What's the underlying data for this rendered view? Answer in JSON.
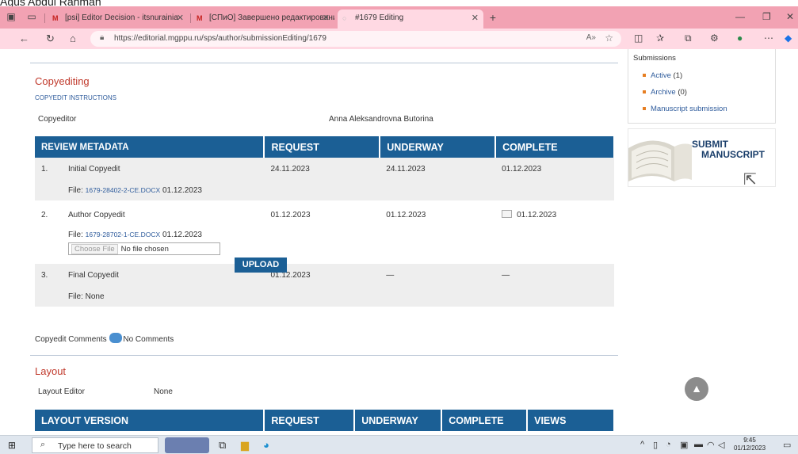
{
  "caption": "Agus Abdul Rahman",
  "browser": {
    "tabs": [
      {
        "label": "[psi] Editor Decision - itsnurainia",
        "favicon": "M"
      },
      {
        "label": "[СПиО] Завершено редактирование",
        "favicon": "M"
      },
      {
        "label": "#1679 Editing",
        "favicon": "loading"
      }
    ],
    "new_tab": "+",
    "url": "https://editorial.mgppu.ru/sps/author/submissionEditing/1679"
  },
  "copyediting": {
    "title": "Copyediting",
    "instructions_link": "COPYEDIT INSTRUCTIONS",
    "copyeditor_label": "Copyeditor",
    "copyeditor_name": "Anna Aleksandrovna Butorina",
    "headers": [
      "REVIEW METADATA",
      "REQUEST",
      "UNDERWAY",
      "COMPLETE"
    ],
    "rows": [
      {
        "num": "1.",
        "name": "Initial Copyedit",
        "request": "24.11.2023",
        "underway": "24.11.2023",
        "complete": "01.12.2023",
        "file_label": "File:",
        "file": "1679-28402-2-CE.DOCX",
        "file_date": "01.12.2023"
      },
      {
        "num": "2.",
        "name": "Author Copyedit",
        "request": "01.12.2023",
        "underway": "01.12.2023",
        "complete": "01.12.2023",
        "file_label": "File:",
        "file": "1679-28702-1-CE.DOCX",
        "file_date": "01.12.2023"
      },
      {
        "num": "3.",
        "name": "Final Copyedit",
        "request": "01.12.2023",
        "underway": "—",
        "complete": "—",
        "file_label": "File: None"
      }
    ],
    "choose_file_button": "Choose File",
    "no_file": "No file chosen",
    "upload_button": "UPLOAD",
    "comments_label": "Copyedit Comments",
    "comments_value": "No Comments"
  },
  "layout": {
    "title": "Layout",
    "editor_label": "Layout Editor",
    "editor_value": "None",
    "headers": [
      "LAYOUT VERSION",
      "REQUEST",
      "UNDERWAY",
      "COMPLETE",
      "VIEWS"
    ]
  },
  "sidebar": {
    "heading": "Submissions",
    "active_label": "Active",
    "active_count": "(1)",
    "archive_label": "Archive",
    "archive_count": "(0)",
    "manuscript_link": "Manuscript submission",
    "submit_line1": "SUBMIT",
    "submit_line2": "MANUSCRIPT"
  },
  "taskbar": {
    "search_placeholder": "Type here to search",
    "time": "9:45",
    "date": "01/12/2023"
  }
}
